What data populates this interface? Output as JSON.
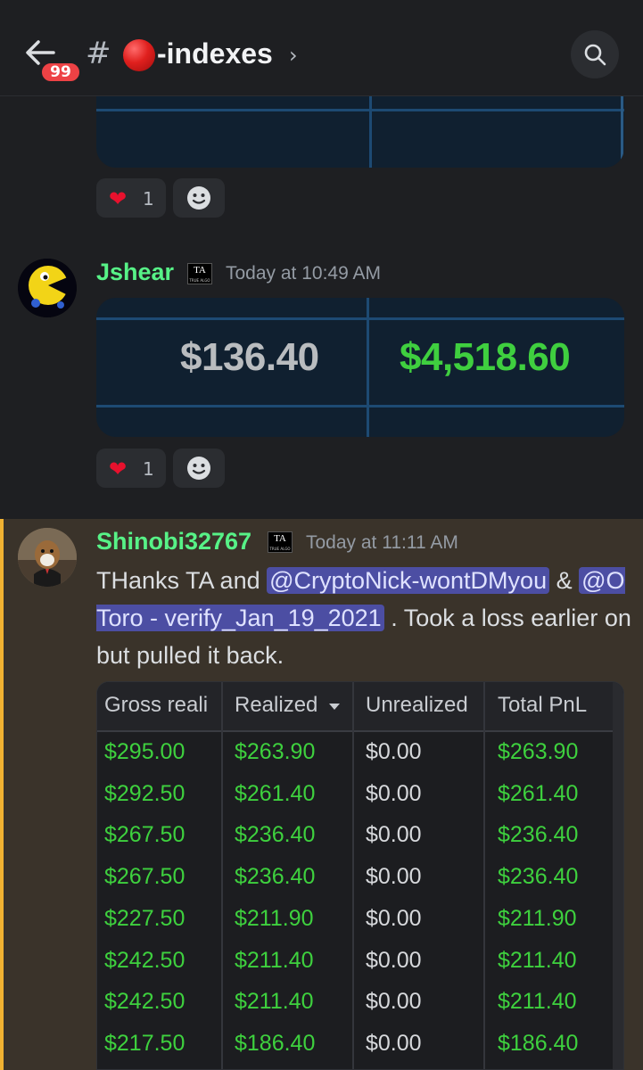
{
  "header": {
    "unread_badge": "99",
    "hash": "#",
    "channel_name": "-indexes",
    "chevron": "›",
    "icons": {
      "back": "arrow-left-icon",
      "search": "search-icon",
      "channel_emoji": "red-circle-icon"
    }
  },
  "colors": {
    "accent_green": "#57f287",
    "highlight_bar": "#f0b232",
    "mention_bg": "#4c4ea3",
    "badge_red": "#ed4245"
  },
  "reactions_top": {
    "heart_count": "1"
  },
  "message_jshear": {
    "username": "Jshear",
    "timestamp": "Today at 10:49 AM",
    "image_values": {
      "left": "$136.40",
      "right": "$4,518.60"
    },
    "reaction_heart_count": "1"
  },
  "message_shinobi": {
    "username": "Shinobi32767",
    "timestamp": "Today at 11:11 AM",
    "text_part1": "THanks TA and ",
    "mention1": "@CryptoNick-wontDMyou",
    "text_part2": " & ",
    "mention2": "@O Toro - verify_Jan_19_2021",
    "text_part3": " . Took a loss earlier on but pulled it back.",
    "table": {
      "headers": [
        "Gross reali",
        "Realized",
        "Unrealized",
        "Total PnL"
      ],
      "rows": [
        [
          "$295.00",
          "$263.90",
          "$0.00",
          "$263.90"
        ],
        [
          "$292.50",
          "$261.40",
          "$0.00",
          "$261.40"
        ],
        [
          "$267.50",
          "$236.40",
          "$0.00",
          "$236.40"
        ],
        [
          "$267.50",
          "$236.40",
          "$0.00",
          "$236.40"
        ],
        [
          "$227.50",
          "$211.90",
          "$0.00",
          "$211.90"
        ],
        [
          "$242.50",
          "$211.40",
          "$0.00",
          "$211.40"
        ],
        [
          "$242.50",
          "$211.40",
          "$0.00",
          "$211.40"
        ],
        [
          "$217.50",
          "$186.40",
          "$0.00",
          "$186.40"
        ]
      ]
    }
  },
  "role_tag": {
    "line1": "TA",
    "line2": "TRUE ALGO"
  }
}
